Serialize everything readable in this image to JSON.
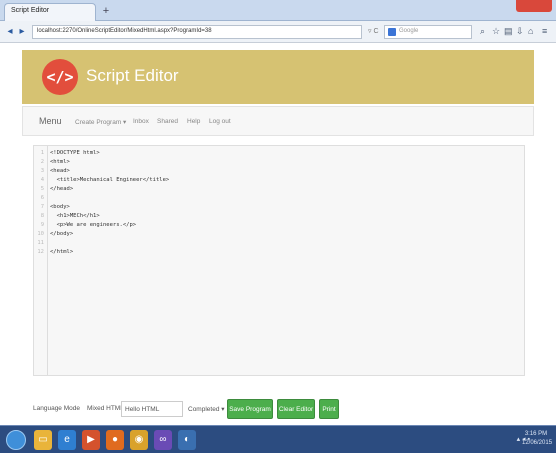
{
  "browser": {
    "tab_title": "Script Editor",
    "new_tab": "+",
    "url": "localhost:2270/OnlineScriptEditor/MixedHtml.aspx?ProgramId=38",
    "search_placeholder": "Google",
    "back": "◂",
    "forward": "▸",
    "url_icons": "▿ C"
  },
  "header": {
    "logo_text": "</>",
    "brand": "Script Editor",
    "color": "#d6c272",
    "logo_color": "#e24e3c"
  },
  "menu": {
    "brand": "Menu",
    "items": [
      "Create Program ▾",
      "Inbox",
      "Shared",
      "Help",
      "Log out"
    ]
  },
  "editor": {
    "lines": [
      {
        "n": "1",
        "code": "<!DOCTYPE html>"
      },
      {
        "n": "2",
        "code": "<html>"
      },
      {
        "n": "3",
        "code": "<head>"
      },
      {
        "n": "4",
        "code": "  <title>Mechanical Engineer</title>"
      },
      {
        "n": "5",
        "code": "</head>"
      },
      {
        "n": "6",
        "code": ""
      },
      {
        "n": "7",
        "code": "<body>"
      },
      {
        "n": "8",
        "code": "  <h1>MECh</h1>"
      },
      {
        "n": "9",
        "code": "  <p>We are engineers.</p>"
      },
      {
        "n": "10",
        "code": "</body>"
      },
      {
        "n": "11",
        "code": ""
      },
      {
        "n": "12",
        "code": "</html>"
      }
    ]
  },
  "bottom": {
    "language_label": "Language Mode",
    "language_value": "Mixed HTML",
    "title_value": "Hello HTML",
    "status_value": "Completed ▾",
    "save_label": "Save Program",
    "clear_label": "Clear Editor",
    "print_label": "Print"
  },
  "taskbar": {
    "time": "3:16 PM",
    "date": "12/06/2015"
  }
}
